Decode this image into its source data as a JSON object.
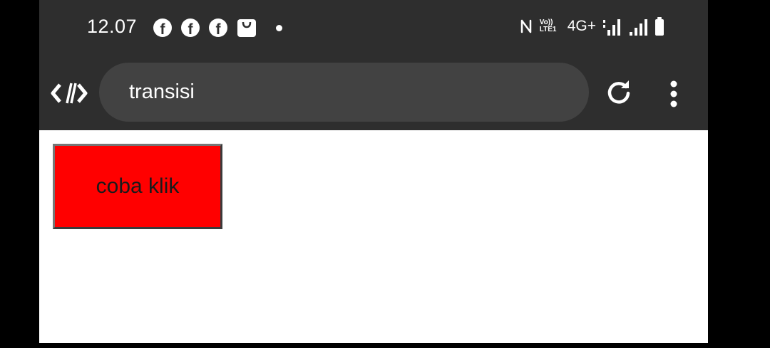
{
  "status_bar": {
    "time": "12.07",
    "notification_icons": [
      "facebook-icon",
      "facebook-icon",
      "facebook-icon",
      "shopping-bag-icon",
      "dot-icon"
    ],
    "volte_label": "Vo)) LTE1",
    "network_label": "4G+",
    "system_icons": [
      "nfc-icon",
      "volte-icon",
      "signal-icon",
      "signal-icon",
      "battery-icon"
    ]
  },
  "toolbar": {
    "url": "transisi",
    "left_icon": "code-icon",
    "right_icons": [
      "reload-icon",
      "menu-icon"
    ]
  },
  "page": {
    "button_label": "coba klik",
    "button_color": "#ff0000"
  },
  "colors": {
    "chrome_bg": "#2e2e2e",
    "url_bar_bg": "#424242",
    "page_bg": "#ffffff",
    "outer_bg": "#000000"
  }
}
